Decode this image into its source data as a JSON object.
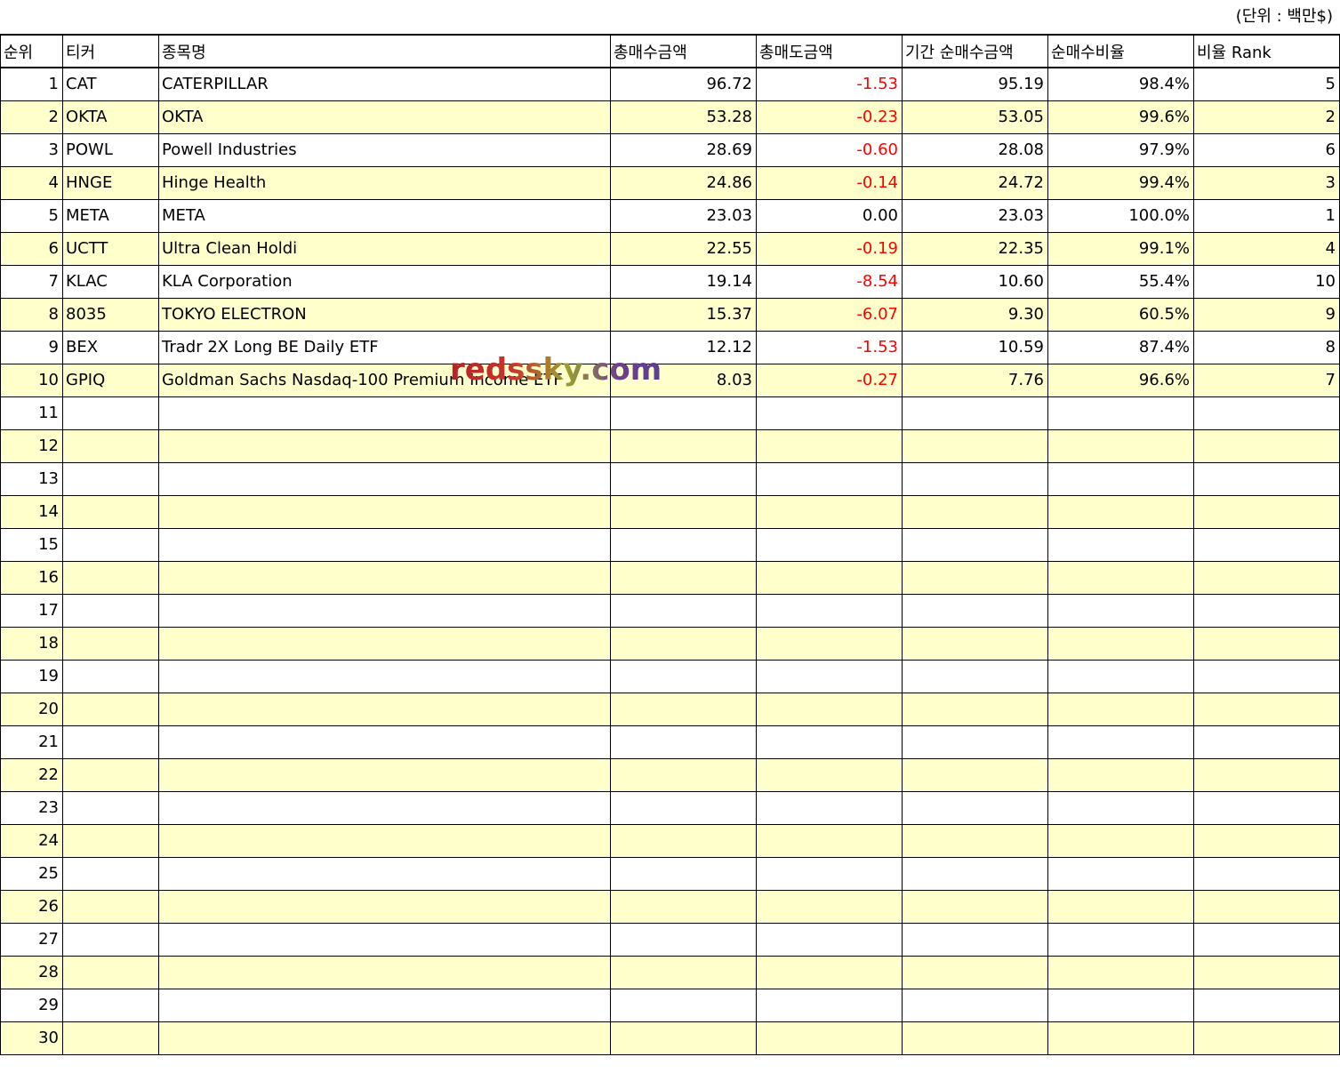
{
  "unit_label": "(단위 : 백만$)",
  "watermark": "redssky.com",
  "headers": [
    "순위",
    "티커",
    "종목명",
    "총매수금액",
    "총매도금액",
    "기간 순매수금액",
    "순매수비율",
    "비율 Rank"
  ],
  "rows": [
    {
      "rank": "1",
      "ticker": "CAT",
      "name": "CATERPILLAR",
      "buy": "96.72",
      "sell": "-1.53",
      "net": "95.19",
      "ratio": "98.4%",
      "ratio_rank": "5"
    },
    {
      "rank": "2",
      "ticker": "OKTA",
      "name": "OKTA",
      "buy": "53.28",
      "sell": "-0.23",
      "net": "53.05",
      "ratio": "99.6%",
      "ratio_rank": "2"
    },
    {
      "rank": "3",
      "ticker": "POWL",
      "name": "Powell Industries",
      "buy": "28.69",
      "sell": "-0.60",
      "net": "28.08",
      "ratio": "97.9%",
      "ratio_rank": "6"
    },
    {
      "rank": "4",
      "ticker": "HNGE",
      "name": "Hinge Health",
      "buy": "24.86",
      "sell": "-0.14",
      "net": "24.72",
      "ratio": "99.4%",
      "ratio_rank": "3"
    },
    {
      "rank": "5",
      "ticker": "META",
      "name": "META",
      "buy": "23.03",
      "sell": "0.00",
      "net": "23.03",
      "ratio": "100.0%",
      "ratio_rank": "1"
    },
    {
      "rank": "6",
      "ticker": "UCTT",
      "name": "Ultra Clean Holdi",
      "buy": "22.55",
      "sell": "-0.19",
      "net": "22.35",
      "ratio": "99.1%",
      "ratio_rank": "4"
    },
    {
      "rank": "7",
      "ticker": "KLAC",
      "name": "KLA Corporation",
      "buy": "19.14",
      "sell": "-8.54",
      "net": "10.60",
      "ratio": "55.4%",
      "ratio_rank": "10"
    },
    {
      "rank": "8",
      "ticker": "8035",
      "name": "TOKYO ELECTRON",
      "buy": "15.37",
      "sell": "-6.07",
      "net": "9.30",
      "ratio": "60.5%",
      "ratio_rank": "9"
    },
    {
      "rank": "9",
      "ticker": "BEX",
      "name": "Tradr 2X Long BE Daily ETF",
      "buy": "12.12",
      "sell": "-1.53",
      "net": "10.59",
      "ratio": "87.4%",
      "ratio_rank": "8"
    },
    {
      "rank": "10",
      "ticker": "GPIQ",
      "name": "Goldman Sachs Nasdaq-100 Premium Income ETF",
      "buy": "8.03",
      "sell": "-0.27",
      "net": "7.76",
      "ratio": "96.6%",
      "ratio_rank": "7"
    },
    {
      "rank": "11"
    },
    {
      "rank": "12"
    },
    {
      "rank": "13"
    },
    {
      "rank": "14"
    },
    {
      "rank": "15"
    },
    {
      "rank": "16"
    },
    {
      "rank": "17"
    },
    {
      "rank": "18"
    },
    {
      "rank": "19"
    },
    {
      "rank": "20"
    },
    {
      "rank": "21"
    },
    {
      "rank": "22"
    },
    {
      "rank": "23"
    },
    {
      "rank": "24"
    },
    {
      "rank": "25"
    },
    {
      "rank": "26"
    },
    {
      "rank": "27"
    },
    {
      "rank": "28"
    },
    {
      "rank": "29"
    },
    {
      "rank": "30"
    }
  ],
  "colors": {
    "negative": "#ff0000",
    "stripe": "#ffffcc"
  }
}
